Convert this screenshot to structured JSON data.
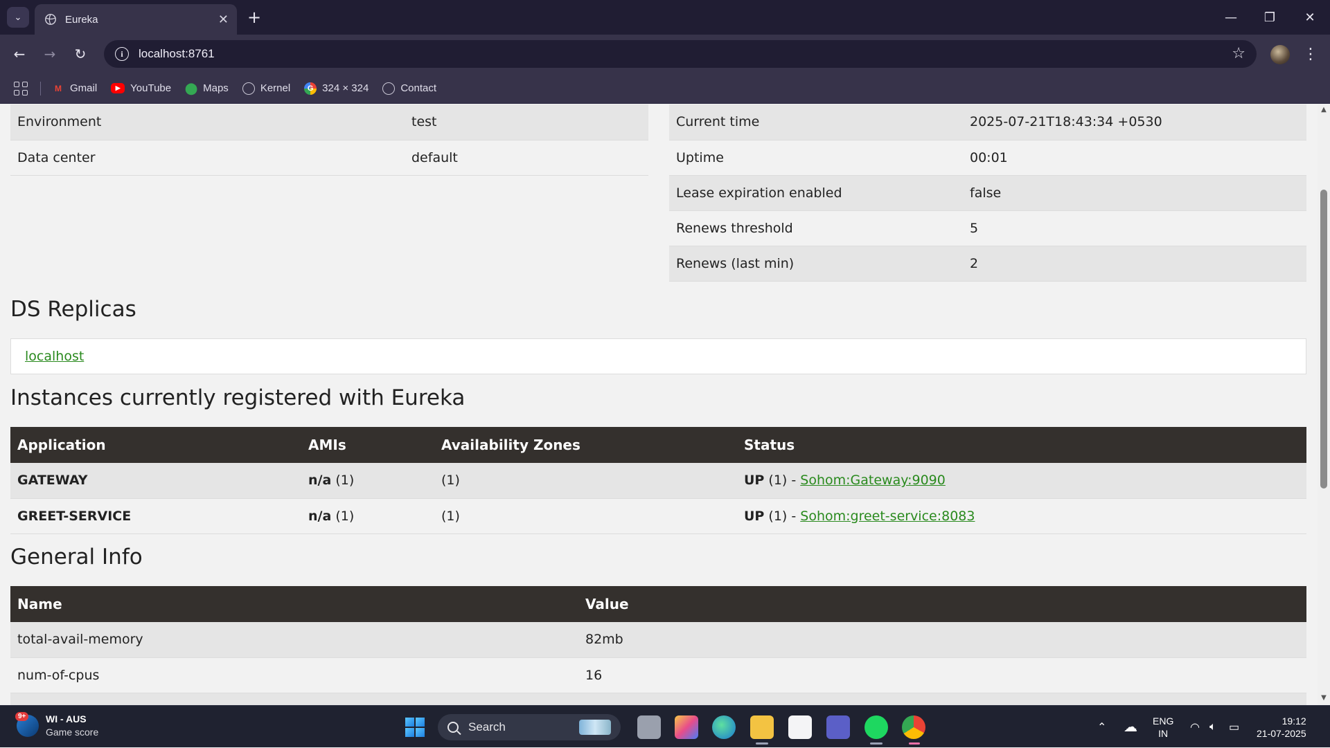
{
  "browser": {
    "tab_title": "Eureka",
    "url": "localhost:8761",
    "bookmarks": [
      {
        "label": "Gmail",
        "icon": "gmail-icon"
      },
      {
        "label": "YouTube",
        "icon": "youtube-icon"
      },
      {
        "label": "Maps",
        "icon": "maps-icon"
      },
      {
        "label": "Kernel",
        "icon": "globe-icon"
      },
      {
        "label": "324 × 324",
        "icon": "google-icon"
      },
      {
        "label": "Contact",
        "icon": "globe-icon"
      }
    ]
  },
  "system_status": {
    "left": [
      {
        "name": "Environment",
        "value": "test"
      },
      {
        "name": "Data center",
        "value": "default"
      }
    ],
    "right": [
      {
        "name": "Current time",
        "value": "2025-07-21T18:43:34 +0530"
      },
      {
        "name": "Uptime",
        "value": "00:01"
      },
      {
        "name": "Lease expiration enabled",
        "value": "false"
      },
      {
        "name": "Renews threshold",
        "value": "5"
      },
      {
        "name": "Renews (last min)",
        "value": "2"
      }
    ]
  },
  "ds_replicas": {
    "title": "DS Replicas",
    "link": "localhost"
  },
  "instances": {
    "title": "Instances currently registered with Eureka",
    "headers": [
      "Application",
      "AMIs",
      "Availability Zones",
      "Status"
    ],
    "rows": [
      {
        "app": "GATEWAY",
        "ami": "n/a",
        "ami_count": "(1)",
        "zones": "(1)",
        "status": "UP",
        "status_count": "(1) -",
        "link": "Sohom:Gateway:9090"
      },
      {
        "app": "GREET-SERVICE",
        "ami": "n/a",
        "ami_count": "(1)",
        "zones": "(1)",
        "status": "UP",
        "status_count": "(1) -",
        "link": "Sohom:greet-service:8083"
      }
    ]
  },
  "general_info": {
    "title": "General Info",
    "headers": [
      "Name",
      "Value"
    ],
    "rows": [
      {
        "name": "total-avail-memory",
        "value": "82mb"
      },
      {
        "name": "num-of-cpus",
        "value": "16"
      }
    ]
  },
  "taskbar": {
    "widget_title": "WI - AUS",
    "widget_sub": "Game score",
    "widget_badge": "9+",
    "search_label": "Search",
    "lang_top": "ENG",
    "lang_bottom": "IN",
    "time": "19:12",
    "date": "21-07-2025"
  }
}
